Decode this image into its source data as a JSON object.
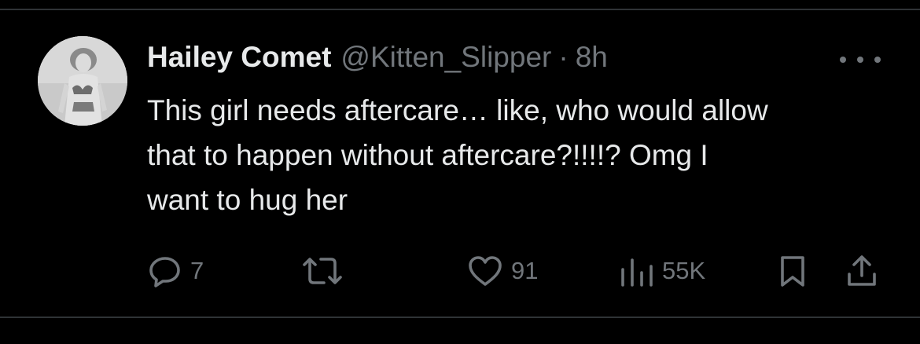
{
  "tweet": {
    "author_name": "Hailey Comet",
    "handle": "@Kitten_Slipper",
    "separator": "·",
    "time": "8h",
    "text": "This girl needs aftercare… like, who would allow\nthat to happen without aftercare?!!!!? Omg I\nwant to hug her"
  },
  "actions": {
    "reply": {
      "icon": "reply-icon",
      "count": "7"
    },
    "retweet": {
      "icon": "retweet-icon",
      "count": ""
    },
    "like": {
      "icon": "heart-icon",
      "count": "91"
    },
    "views": {
      "icon": "views-chart-icon",
      "count": "55K"
    },
    "bookmark": {
      "icon": "bookmark-icon"
    },
    "share": {
      "icon": "share-icon"
    }
  },
  "colors": {
    "background": "#000000",
    "primary_text": "#e7e9ea",
    "secondary_text": "#71767b",
    "divider": "#2f3336"
  }
}
